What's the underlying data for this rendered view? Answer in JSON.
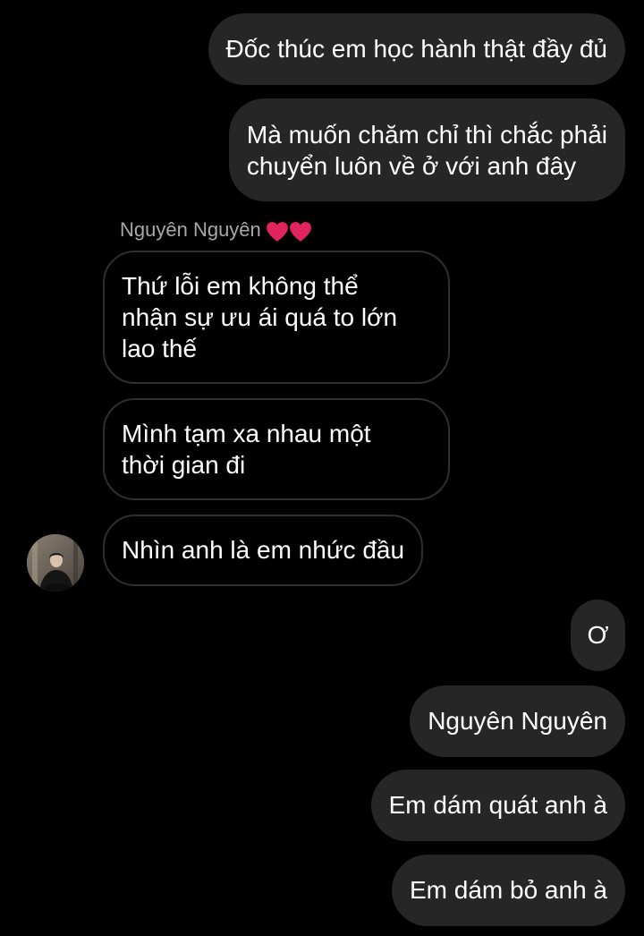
{
  "thread": {
    "contact_name": "Nguyên Nguyên",
    "contact_emoji": [
      "red-heart",
      "red-heart"
    ],
    "heart_color": "#e0245e"
  },
  "messages": [
    {
      "from": "me",
      "lines": [
        "Đốc thúc em học hành thật đầy đủ"
      ]
    },
    {
      "from": "me",
      "lines": [
        "Mà muốn chăm chỉ thì chắc phải",
        "chuyển luôn về ở với anh đây"
      ]
    },
    {
      "from": "them",
      "lines": [
        "Thứ lỗi em không thể",
        "nhận sự ưu ái quá to lớn",
        "lao thế"
      ]
    },
    {
      "from": "them",
      "lines": [
        "Mình tạm xa nhau một",
        "thời gian đi"
      ]
    },
    {
      "from": "them",
      "lines": [
        "Nhìn anh là em nhức đầu"
      ]
    },
    {
      "from": "me",
      "lines": [
        "Ơ"
      ]
    },
    {
      "from": "me",
      "lines": [
        "Nguyên Nguyên"
      ]
    },
    {
      "from": "me",
      "lines": [
        "Em dám quát anh à"
      ]
    },
    {
      "from": "me",
      "lines": [
        "Em dám bỏ anh à"
      ]
    }
  ],
  "colors": {
    "background": "#000000",
    "outgoing_bubble": "#262626",
    "incoming_border": "#2f2f2f",
    "text": "#ffffff",
    "sender_name": "#a8a8a8"
  }
}
